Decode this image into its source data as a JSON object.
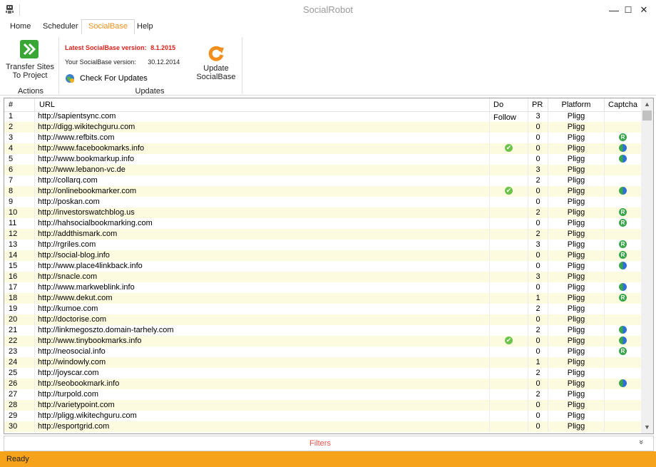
{
  "window": {
    "title": "SocialRobot",
    "minimize": "—",
    "maximize": "☐",
    "close": "✕"
  },
  "tabs": [
    {
      "label": "Home",
      "active": false
    },
    {
      "label": "Scheduler",
      "active": false
    },
    {
      "label": "SocialBase",
      "active": true
    },
    {
      "label": "Help",
      "active": false
    }
  ],
  "ribbon": {
    "transfer_label_1": "Transfer Sites",
    "transfer_label_2": "To Project",
    "actions_group": "Actions",
    "latest_version_label": "Latest SocialBase version:",
    "latest_version": "8.1.2015",
    "your_version_label": "Your SocialBase version:",
    "your_version": "30.12.2014",
    "check_updates": "Check For Updates",
    "update_label_1": "Update",
    "update_label_2": "SocialBase",
    "updates_group": "Updates"
  },
  "colors": {
    "accent": "#f28f1c",
    "status_bar": "#f7a21b",
    "row_alt": "#fdfbdf",
    "latest_version": "#e0201b",
    "filters_text": "#e8544a"
  },
  "table": {
    "columns": [
      "#",
      "URL",
      "Do Follow",
      "PR",
      "Platform",
      "Captcha"
    ],
    "rows": [
      {
        "n": "1",
        "url": "http://sapientsync.com",
        "df": false,
        "pr": "3",
        "platform": "Pligg",
        "captcha": ""
      },
      {
        "n": "2",
        "url": "http://digg.wikitechguru.com",
        "df": false,
        "pr": "0",
        "platform": "Pligg",
        "captcha": ""
      },
      {
        "n": "3",
        "url": "http://www.refbits.com",
        "df": false,
        "pr": "0",
        "platform": "Pligg",
        "captcha": "recaptcha"
      },
      {
        "n": "4",
        "url": "http://www.facebookmarks.info",
        "df": true,
        "pr": "0",
        "platform": "Pligg",
        "captcha": "solvemedia"
      },
      {
        "n": "5",
        "url": "http://www.bookmarkup.info",
        "df": false,
        "pr": "0",
        "platform": "Pligg",
        "captcha": "solvemedia"
      },
      {
        "n": "6",
        "url": "http://www.lebanon-vc.de",
        "df": false,
        "pr": "3",
        "platform": "Pligg",
        "captcha": ""
      },
      {
        "n": "7",
        "url": "http://collarq.com",
        "df": false,
        "pr": "2",
        "platform": "Pligg",
        "captcha": ""
      },
      {
        "n": "8",
        "url": "http://onlinebookmarker.com",
        "df": true,
        "pr": "0",
        "platform": "Pligg",
        "captcha": "solvemedia"
      },
      {
        "n": "9",
        "url": "http://poskan.com",
        "df": false,
        "pr": "0",
        "platform": "Pligg",
        "captcha": ""
      },
      {
        "n": "10",
        "url": "http://investorswatchblog.us",
        "df": false,
        "pr": "2",
        "platform": "Pligg",
        "captcha": "recaptcha"
      },
      {
        "n": "11",
        "url": "http://hahsocialbookmarking.com",
        "df": false,
        "pr": "0",
        "platform": "Pligg",
        "captcha": "recaptcha"
      },
      {
        "n": "12",
        "url": "http://addthismark.com",
        "df": false,
        "pr": "2",
        "platform": "Pligg",
        "captcha": ""
      },
      {
        "n": "13",
        "url": "http://rgriles.com",
        "df": false,
        "pr": "3",
        "platform": "Pligg",
        "captcha": "recaptcha"
      },
      {
        "n": "14",
        "url": "http://social-blog.info",
        "df": false,
        "pr": "0",
        "platform": "Pligg",
        "captcha": "recaptcha"
      },
      {
        "n": "15",
        "url": "http://www.place4linkback.info",
        "df": false,
        "pr": "0",
        "platform": "Pligg",
        "captcha": "solvemedia"
      },
      {
        "n": "16",
        "url": "http://snacle.com",
        "df": false,
        "pr": "3",
        "platform": "Pligg",
        "captcha": ""
      },
      {
        "n": "17",
        "url": "http://www.markweblink.info",
        "df": false,
        "pr": "0",
        "platform": "Pligg",
        "captcha": "solvemedia"
      },
      {
        "n": "18",
        "url": "http://www.dekut.com",
        "df": false,
        "pr": "1",
        "platform": "Pligg",
        "captcha": "recaptcha"
      },
      {
        "n": "19",
        "url": "http://kumoe.com",
        "df": false,
        "pr": "2",
        "platform": "Pligg",
        "captcha": ""
      },
      {
        "n": "20",
        "url": "http://doctorise.com",
        "df": false,
        "pr": "0",
        "platform": "Pligg",
        "captcha": ""
      },
      {
        "n": "21",
        "url": "http://linkmegoszto.domain-tarhely.com",
        "df": false,
        "pr": "2",
        "platform": "Pligg",
        "captcha": "solvemedia"
      },
      {
        "n": "22",
        "url": "http://www.tinybookmarks.info",
        "df": true,
        "pr": "0",
        "platform": "Pligg",
        "captcha": "solvemedia"
      },
      {
        "n": "23",
        "url": "http://neosocial.info",
        "df": false,
        "pr": "0",
        "platform": "Pligg",
        "captcha": "recaptcha"
      },
      {
        "n": "24",
        "url": "http://windowly.com",
        "df": false,
        "pr": "1",
        "platform": "Pligg",
        "captcha": ""
      },
      {
        "n": "25",
        "url": "http://joyscar.com",
        "df": false,
        "pr": "2",
        "platform": "Pligg",
        "captcha": ""
      },
      {
        "n": "26",
        "url": "http://seobookmark.info",
        "df": false,
        "pr": "0",
        "platform": "Pligg",
        "captcha": "solvemedia"
      },
      {
        "n": "27",
        "url": "http://turpold.com",
        "df": false,
        "pr": "2",
        "platform": "Pligg",
        "captcha": ""
      },
      {
        "n": "28",
        "url": "http://varietypoint.com",
        "df": false,
        "pr": "0",
        "platform": "Pligg",
        "captcha": ""
      },
      {
        "n": "29",
        "url": "http://pligg.wikitechguru.com",
        "df": false,
        "pr": "0",
        "platform": "Pligg",
        "captcha": ""
      },
      {
        "n": "30",
        "url": "http://esportgrid.com",
        "df": false,
        "pr": "0",
        "platform": "Pligg",
        "captcha": ""
      }
    ]
  },
  "filters": {
    "label": "Filters",
    "chevron": "»"
  },
  "status": {
    "text": "Ready"
  }
}
